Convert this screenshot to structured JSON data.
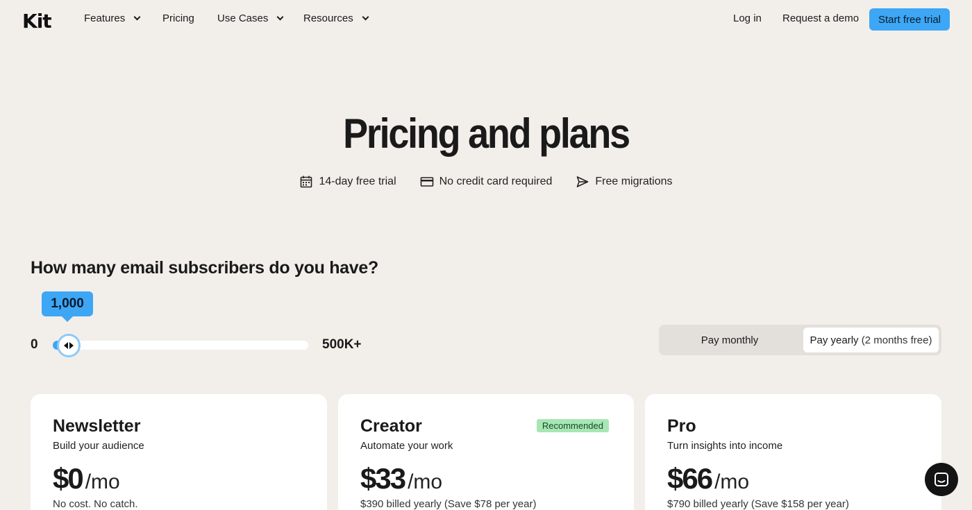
{
  "nav": {
    "logo": "Kit",
    "items": [
      {
        "label": "Features",
        "dropdown": true
      },
      {
        "label": "Pricing",
        "dropdown": false
      },
      {
        "label": "Use Cases",
        "dropdown": true
      },
      {
        "label": "Resources",
        "dropdown": true
      }
    ],
    "login": "Log in",
    "demo": "Request a demo",
    "trial": "Start free trial"
  },
  "hero": {
    "title": "Pricing and plans",
    "perks": [
      {
        "icon": "calendar-icon",
        "label": "14-day free trial"
      },
      {
        "icon": "credit-card-icon",
        "label": "No credit card required"
      },
      {
        "icon": "send-icon",
        "label": "Free migrations"
      }
    ]
  },
  "subscribers": {
    "question": "How many email subscribers do you have?",
    "value_label": "1,000",
    "min_label": "0",
    "max_label": "500K+",
    "value": 1000,
    "max": 500000
  },
  "billing_toggle": {
    "monthly": "Pay monthly",
    "yearly_bold": "Pay yearly",
    "yearly_note": "(2 months free)",
    "selected": "yearly"
  },
  "plans": [
    {
      "name": "Newsletter",
      "tagline": "Build your audience",
      "price": "$0",
      "per": "/mo",
      "billing": "No cost. No catch.",
      "badge": ""
    },
    {
      "name": "Creator",
      "tagline": "Automate your work",
      "price": "$33",
      "per": "/mo",
      "billing": "$390 billed yearly (Save $78 per year)",
      "badge": "Recommended"
    },
    {
      "name": "Pro",
      "tagline": "Turn insights into income",
      "price": "$66",
      "per": "/mo",
      "billing": "$790 billed yearly (Save $158 per year)",
      "badge": ""
    }
  ],
  "colors": {
    "accent": "#3da6f5",
    "background": "#f2efeb",
    "badge": "#a8e6b5"
  }
}
